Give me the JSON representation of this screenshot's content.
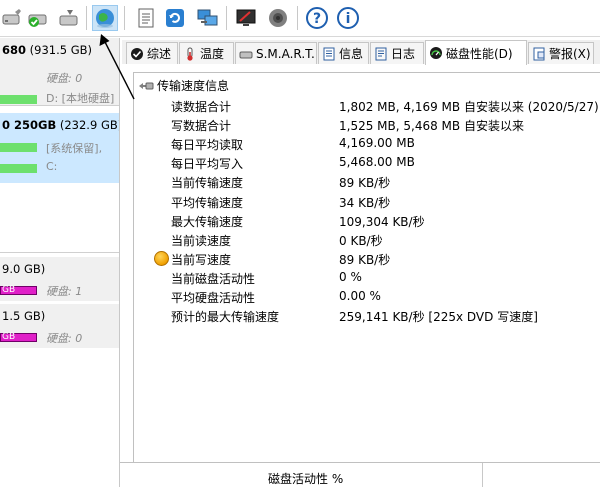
{
  "toolbar": {
    "buttons": [
      {
        "name": "drive-icon",
        "tip": ""
      },
      {
        "name": "drive-check-icon",
        "tip": ""
      },
      {
        "name": "drive-wrench-icon",
        "tip": ""
      },
      {
        "name": "globe-icon",
        "tip": ""
      },
      {
        "name": "document-icon",
        "tip": ""
      },
      {
        "name": "refresh-icon",
        "tip": ""
      },
      {
        "name": "network-computer-icon",
        "tip": ""
      },
      {
        "name": "monitor-edit-icon",
        "tip": ""
      },
      {
        "name": "speaker-icon",
        "tip": ""
      },
      {
        "name": "help-icon",
        "tip": ""
      },
      {
        "name": "info-icon",
        "tip": ""
      }
    ]
  },
  "disks": [
    {
      "title_bold": "680",
      "title_rest": " (931.5 GB)",
      "label": "硬盘",
      "label_num": ": 0",
      "part": "D: [本地硬盘]"
    },
    {
      "title_bold": "0 250GB",
      "title_rest": " (232.9 GB)",
      "part_a": "[系统保留],",
      "part_b": "C:"
    },
    {
      "title_rest": "9.0 GB)",
      "bar_text": "GB",
      "label": "硬盘",
      "label_num": ": 1"
    },
    {
      "title_rest": "1.5 GB)",
      "bar_text": "GB",
      "label": "硬盘",
      "label_num": ": 0"
    }
  ],
  "tabs": [
    {
      "label": "综述",
      "icon": "check-icon"
    },
    {
      "label": "温度",
      "icon": "thermometer-icon"
    },
    {
      "label": "S.M.A.R.T.",
      "icon": "drive-icon"
    },
    {
      "label": "信息",
      "icon": "document-icon"
    },
    {
      "label": "日志",
      "icon": "log-icon"
    },
    {
      "label": "磁盘性能(D)",
      "icon": "gauge-icon"
    },
    {
      "label": "警报(X)",
      "icon": "alert-icon"
    }
  ],
  "performance": {
    "header": "传输速度信息",
    "rows": [
      {
        "label": "读数据合计",
        "value": "1,802 MB,  4,169 MB 自安装以来 (2020/5/27)"
      },
      {
        "label": "写数据合计",
        "value": "1,525 MB,  5,468 MB 自安装以来"
      },
      {
        "label": "每日平均读取",
        "value": "4,169.00 MB"
      },
      {
        "label": "每日平均写入",
        "value": "5,468.00 MB"
      },
      {
        "label": "当前传输速度",
        "value": "89 KB/秒"
      },
      {
        "label": "平均传输速度",
        "value": "34 KB/秒"
      },
      {
        "label": "最大传输速度",
        "value": "109,304 KB/秒"
      },
      {
        "label": "当前读速度",
        "value": "0 KB/秒"
      },
      {
        "label": "当前写速度",
        "value": "89 KB/秒"
      },
      {
        "label": "当前磁盘活动性",
        "value": "0 %"
      },
      {
        "label": "平均硬盘活动性",
        "value": "0.00 %"
      },
      {
        "label": "预计的最大传输速度",
        "value": "259,141 KB/秒 [225x DVD 写速度]"
      }
    ]
  },
  "bottom": {
    "title": "磁盘活动性 %"
  },
  "colors": {
    "accent": "#cce8ff",
    "bar_green": "#6de06d",
    "bar_magenta": "#e020c8",
    "dot": "#f0a000"
  }
}
